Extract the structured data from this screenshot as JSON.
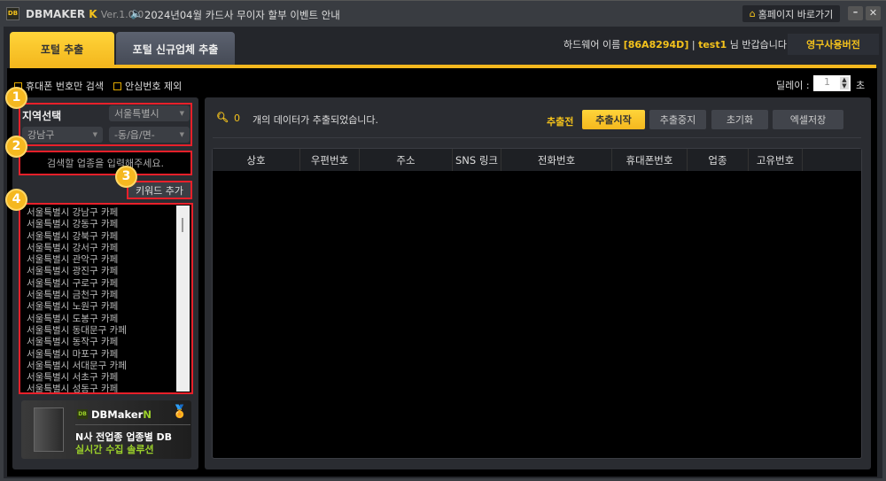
{
  "titlebar": {
    "logo": "DB",
    "app_name": "DBMAKER",
    "app_suffix": "K",
    "version": "Ver.1.0.0",
    "notice": "2024년04월 카드사 무이자 할부 이벤트 안내",
    "homepage_button": "홈페이지 바로가기"
  },
  "tabs": [
    {
      "label": "포털 추출",
      "active": true
    },
    {
      "label": "포털 신규업체 추출",
      "active": false
    }
  ],
  "header": {
    "hw_label": "하드웨어 이름",
    "hw_id": "[86A8294D]",
    "sep": "|",
    "user": "test1",
    "greeting": "님 반갑습니다!",
    "license_button": "영구사용버전"
  },
  "options": {
    "mobile_only": "휴대폰 번호만 검색",
    "exclude_safe": "안심번호 제외",
    "delay_label": "딜레이 :",
    "delay_value": "1",
    "delay_unit": "초"
  },
  "left": {
    "region_label": "지역선택",
    "city": "서울특별시",
    "district": "강남구",
    "dong": "-동/읍/면-",
    "keyword_placeholder": "검색할 업종을 입력해주세요.",
    "add_keyword": "키워드 추가",
    "markers": [
      "1",
      "2",
      "3",
      "4"
    ],
    "keywords": [
      "서울특별시 강남구 카페",
      "서울특별시 강동구 카페",
      "서울특별시 강북구 카페",
      "서울특별시 강서구 카페",
      "서울특별시 관악구 카페",
      "서울특별시 광진구 카페",
      "서울특별시 구로구 카페",
      "서울특별시 금천구 카페",
      "서울특별시 노원구 카페",
      "서울특별시 도봉구 카페",
      "서울특별시 동대문구 카페",
      "서울특별시 동작구 카페",
      "서울특별시 마포구 카페",
      "서울특별시 서대문구 카페",
      "서울특별시 서초구 카페",
      "서울특별시 성동구 카페"
    ],
    "banner": {
      "logo": "DB",
      "brand": "DBMaker",
      "brand_suffix": "N",
      "line1": "N사 전업종 업종별 DB",
      "line2": "실시간 수집 솔루션"
    }
  },
  "right": {
    "count": "0",
    "count_text": "개의 데이터가 추출되었습니다.",
    "state": "추출전",
    "buttons": [
      "추출시작",
      "추출중지",
      "초기화",
      "엑셀저장"
    ],
    "columns": [
      "상호",
      "우편번호",
      "주소",
      "SNS 링크",
      "전화번호",
      "휴대폰번호",
      "업종",
      "고유번호"
    ]
  },
  "colors": {
    "accent": "#f4b81e",
    "marker_red": "#e8202a"
  }
}
